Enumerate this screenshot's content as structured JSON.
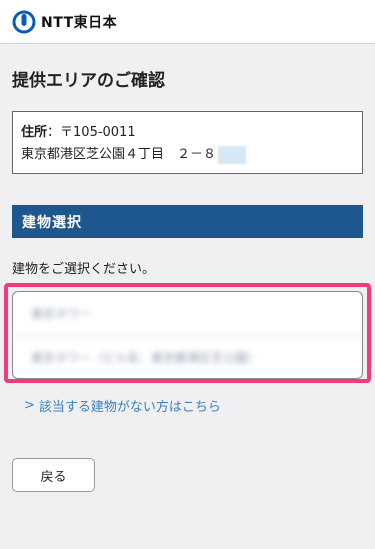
{
  "brand": {
    "name": "NTT東日本",
    "logo_icon": "ntt-logo-icon",
    "color": "#0a5bb5"
  },
  "page": {
    "title": "提供エリアのご確認"
  },
  "address": {
    "label": "住所",
    "separator": "：",
    "postal": "〒105-0011",
    "line2": "東京都港区芝公園４丁目　２－８"
  },
  "section": {
    "title": "建物選択",
    "color": "#1e578f"
  },
  "prompt": "建物をご選択ください。",
  "buildings": [
    {
      "label": "東京タワー"
    },
    {
      "label": "東京タワー（ビル名：東京都港区芝公園）"
    }
  ],
  "highlight_color": "#f13b7a",
  "link": {
    "icon": "chevron-right-icon",
    "chevron": ">",
    "text": "該当する建物がない方はこちら",
    "color": "#3a82c0"
  },
  "back_button": {
    "label": "戻る"
  }
}
